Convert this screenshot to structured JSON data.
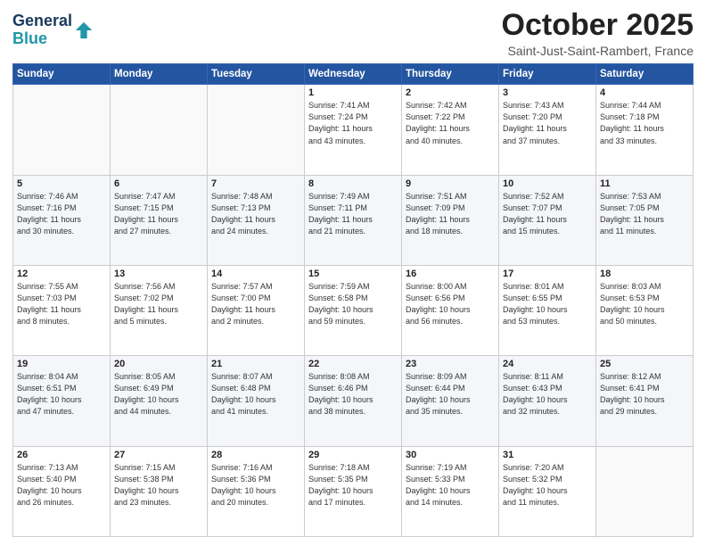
{
  "header": {
    "logo_line1": "General",
    "logo_line2": "Blue",
    "month": "October 2025",
    "location": "Saint-Just-Saint-Rambert, France"
  },
  "weekdays": [
    "Sunday",
    "Monday",
    "Tuesday",
    "Wednesday",
    "Thursday",
    "Friday",
    "Saturday"
  ],
  "weeks": [
    [
      {
        "day": "",
        "info": ""
      },
      {
        "day": "",
        "info": ""
      },
      {
        "day": "",
        "info": ""
      },
      {
        "day": "1",
        "info": "Sunrise: 7:41 AM\nSunset: 7:24 PM\nDaylight: 11 hours\nand 43 minutes."
      },
      {
        "day": "2",
        "info": "Sunrise: 7:42 AM\nSunset: 7:22 PM\nDaylight: 11 hours\nand 40 minutes."
      },
      {
        "day": "3",
        "info": "Sunrise: 7:43 AM\nSunset: 7:20 PM\nDaylight: 11 hours\nand 37 minutes."
      },
      {
        "day": "4",
        "info": "Sunrise: 7:44 AM\nSunset: 7:18 PM\nDaylight: 11 hours\nand 33 minutes."
      }
    ],
    [
      {
        "day": "5",
        "info": "Sunrise: 7:46 AM\nSunset: 7:16 PM\nDaylight: 11 hours\nand 30 minutes."
      },
      {
        "day": "6",
        "info": "Sunrise: 7:47 AM\nSunset: 7:15 PM\nDaylight: 11 hours\nand 27 minutes."
      },
      {
        "day": "7",
        "info": "Sunrise: 7:48 AM\nSunset: 7:13 PM\nDaylight: 11 hours\nand 24 minutes."
      },
      {
        "day": "8",
        "info": "Sunrise: 7:49 AM\nSunset: 7:11 PM\nDaylight: 11 hours\nand 21 minutes."
      },
      {
        "day": "9",
        "info": "Sunrise: 7:51 AM\nSunset: 7:09 PM\nDaylight: 11 hours\nand 18 minutes."
      },
      {
        "day": "10",
        "info": "Sunrise: 7:52 AM\nSunset: 7:07 PM\nDaylight: 11 hours\nand 15 minutes."
      },
      {
        "day": "11",
        "info": "Sunrise: 7:53 AM\nSunset: 7:05 PM\nDaylight: 11 hours\nand 11 minutes."
      }
    ],
    [
      {
        "day": "12",
        "info": "Sunrise: 7:55 AM\nSunset: 7:03 PM\nDaylight: 11 hours\nand 8 minutes."
      },
      {
        "day": "13",
        "info": "Sunrise: 7:56 AM\nSunset: 7:02 PM\nDaylight: 11 hours\nand 5 minutes."
      },
      {
        "day": "14",
        "info": "Sunrise: 7:57 AM\nSunset: 7:00 PM\nDaylight: 11 hours\nand 2 minutes."
      },
      {
        "day": "15",
        "info": "Sunrise: 7:59 AM\nSunset: 6:58 PM\nDaylight: 10 hours\nand 59 minutes."
      },
      {
        "day": "16",
        "info": "Sunrise: 8:00 AM\nSunset: 6:56 PM\nDaylight: 10 hours\nand 56 minutes."
      },
      {
        "day": "17",
        "info": "Sunrise: 8:01 AM\nSunset: 6:55 PM\nDaylight: 10 hours\nand 53 minutes."
      },
      {
        "day": "18",
        "info": "Sunrise: 8:03 AM\nSunset: 6:53 PM\nDaylight: 10 hours\nand 50 minutes."
      }
    ],
    [
      {
        "day": "19",
        "info": "Sunrise: 8:04 AM\nSunset: 6:51 PM\nDaylight: 10 hours\nand 47 minutes."
      },
      {
        "day": "20",
        "info": "Sunrise: 8:05 AM\nSunset: 6:49 PM\nDaylight: 10 hours\nand 44 minutes."
      },
      {
        "day": "21",
        "info": "Sunrise: 8:07 AM\nSunset: 6:48 PM\nDaylight: 10 hours\nand 41 minutes."
      },
      {
        "day": "22",
        "info": "Sunrise: 8:08 AM\nSunset: 6:46 PM\nDaylight: 10 hours\nand 38 minutes."
      },
      {
        "day": "23",
        "info": "Sunrise: 8:09 AM\nSunset: 6:44 PM\nDaylight: 10 hours\nand 35 minutes."
      },
      {
        "day": "24",
        "info": "Sunrise: 8:11 AM\nSunset: 6:43 PM\nDaylight: 10 hours\nand 32 minutes."
      },
      {
        "day": "25",
        "info": "Sunrise: 8:12 AM\nSunset: 6:41 PM\nDaylight: 10 hours\nand 29 minutes."
      }
    ],
    [
      {
        "day": "26",
        "info": "Sunrise: 7:13 AM\nSunset: 5:40 PM\nDaylight: 10 hours\nand 26 minutes."
      },
      {
        "day": "27",
        "info": "Sunrise: 7:15 AM\nSunset: 5:38 PM\nDaylight: 10 hours\nand 23 minutes."
      },
      {
        "day": "28",
        "info": "Sunrise: 7:16 AM\nSunset: 5:36 PM\nDaylight: 10 hours\nand 20 minutes."
      },
      {
        "day": "29",
        "info": "Sunrise: 7:18 AM\nSunset: 5:35 PM\nDaylight: 10 hours\nand 17 minutes."
      },
      {
        "day": "30",
        "info": "Sunrise: 7:19 AM\nSunset: 5:33 PM\nDaylight: 10 hours\nand 14 minutes."
      },
      {
        "day": "31",
        "info": "Sunrise: 7:20 AM\nSunset: 5:32 PM\nDaylight: 10 hours\nand 11 minutes."
      },
      {
        "day": "",
        "info": ""
      }
    ]
  ]
}
